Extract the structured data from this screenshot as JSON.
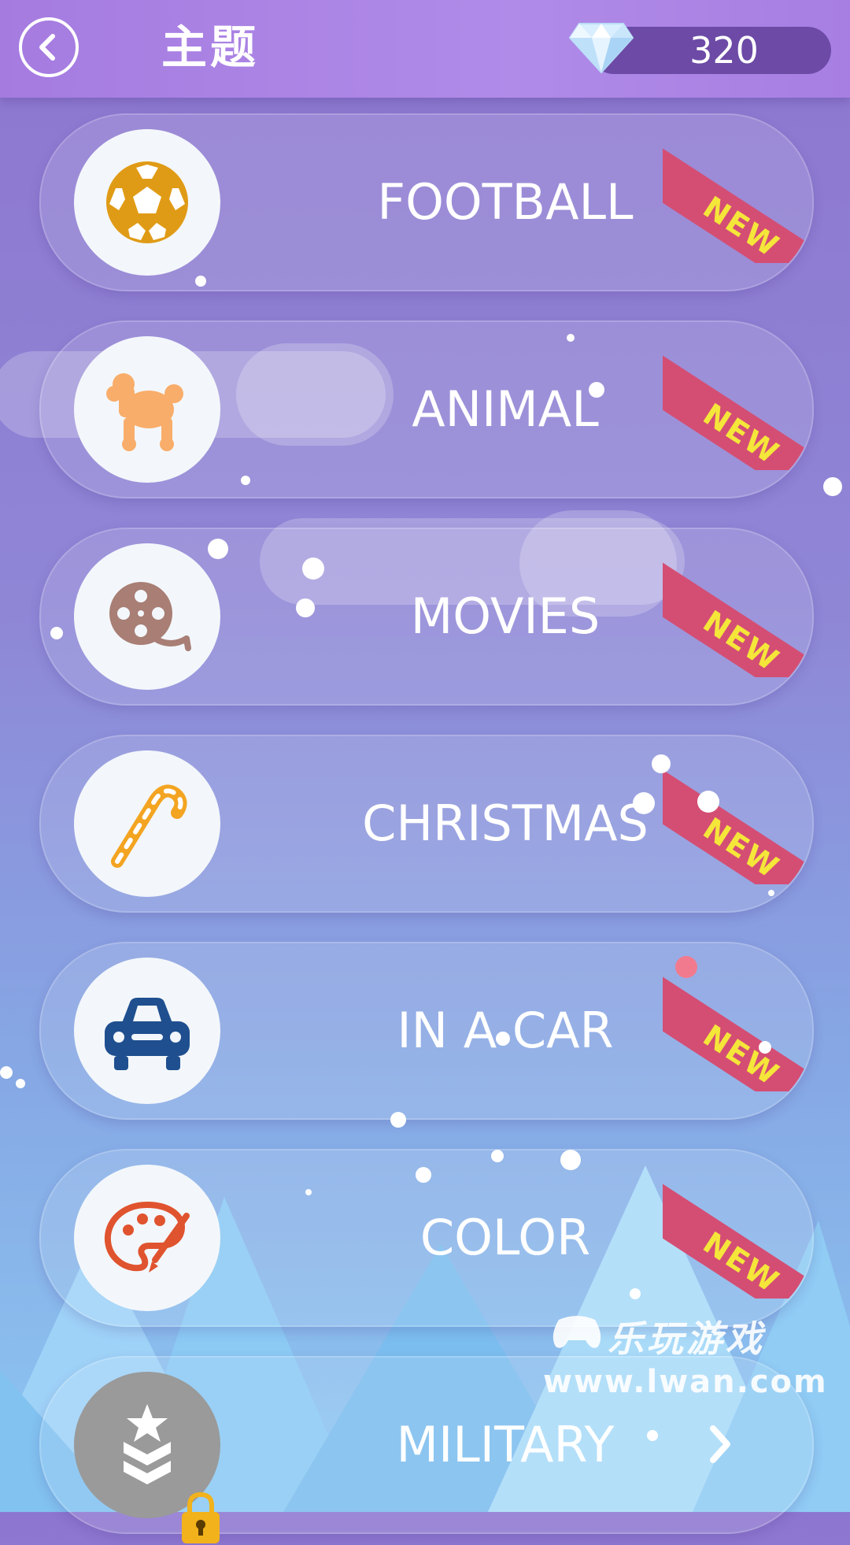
{
  "header": {
    "title": "主题",
    "gem_count": "320"
  },
  "categories": [
    {
      "label": "FOOTBALL",
      "badge": "NEW",
      "icon": "soccer-ball-icon",
      "locked": false
    },
    {
      "label": "ANIMAL",
      "badge": "NEW",
      "icon": "poodle-icon",
      "locked": false
    },
    {
      "label": "MOVIES",
      "badge": "NEW",
      "icon": "film-reel-icon",
      "locked": false
    },
    {
      "label": "CHRISTMAS",
      "badge": "NEW",
      "icon": "candy-cane-icon",
      "locked": false
    },
    {
      "label": "IN A CAR",
      "badge": "NEW",
      "icon": "car-icon",
      "locked": false
    },
    {
      "label": "COLOR",
      "badge": "NEW",
      "icon": "palette-icon",
      "locked": false
    },
    {
      "label": "MILITARY",
      "badge": "",
      "icon": "military-rank-icon",
      "locked": true
    }
  ],
  "watermark": {
    "title": "乐玩游戏",
    "url": "www.lwan.com"
  },
  "colors": {
    "header_bg": "#a97fe3",
    "ribbon": "#d44e74",
    "ribbon_text": "#f5e63a",
    "football_icon": "#e09b16",
    "animal_icon": "#f9ad6a",
    "movies_icon": "#a87e75",
    "christmas_icon": "#f3a421",
    "car_icon": "#1f4f8f",
    "color_icon": "#e0532f"
  }
}
